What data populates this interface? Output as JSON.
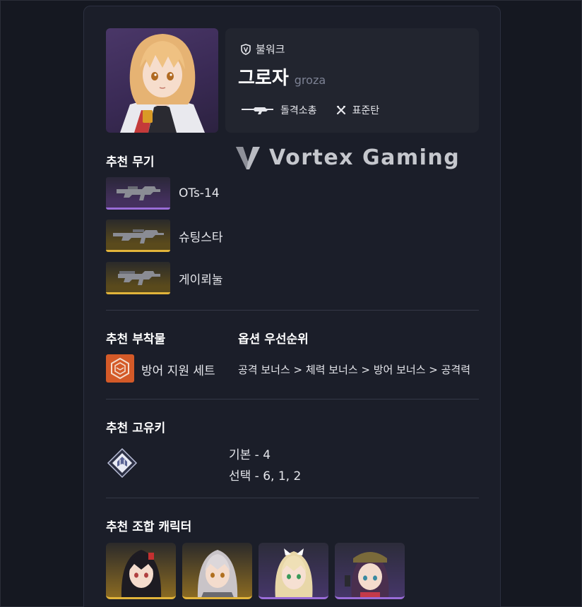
{
  "character": {
    "faction": "불워크",
    "name": "그로자",
    "name_en": "groza",
    "weapon_type": "돌격소총",
    "ammo_type": "표준탄"
  },
  "logo": {
    "text": "Vortex Gaming"
  },
  "weapons": {
    "title": "추천 무기",
    "items": [
      {
        "name": "OTs-14",
        "rarity": "purple"
      },
      {
        "name": "슈팅스타",
        "rarity": "gold"
      },
      {
        "name": "게이뢰눌",
        "rarity": "gold"
      }
    ]
  },
  "attachments": {
    "title": "추천 부착물",
    "set_name": "방어 지원 세트"
  },
  "options": {
    "title": "옵션 우선순위",
    "priority": "공격 보너스 > 체력 보너스 > 방어 보너스 > 공격력"
  },
  "key": {
    "title": "추천 고유키",
    "basic": "기본 - 4",
    "select": "선택 - 6, 1, 2"
  },
  "team": {
    "title": "추천 조합 캐릭터",
    "members": [
      {
        "rarity": "gold",
        "hair": "#1d1b22",
        "bg": "#7a5a1c"
      },
      {
        "rarity": "gold",
        "hair": "#c9c4c8",
        "bg": "#7a5a1c"
      },
      {
        "rarity": "purple",
        "hair": "#e8d7a8",
        "bg": "#3a3254"
      },
      {
        "rarity": "purple",
        "hair": "#4a2f4e",
        "bg": "#3a3254"
      }
    ]
  },
  "colors": {
    "background": "#151821",
    "card": "#1b1e29",
    "purple_rarity": "#9a6cd8",
    "gold_rarity": "#e2b43a",
    "attachment_orange": "#d45a28"
  }
}
